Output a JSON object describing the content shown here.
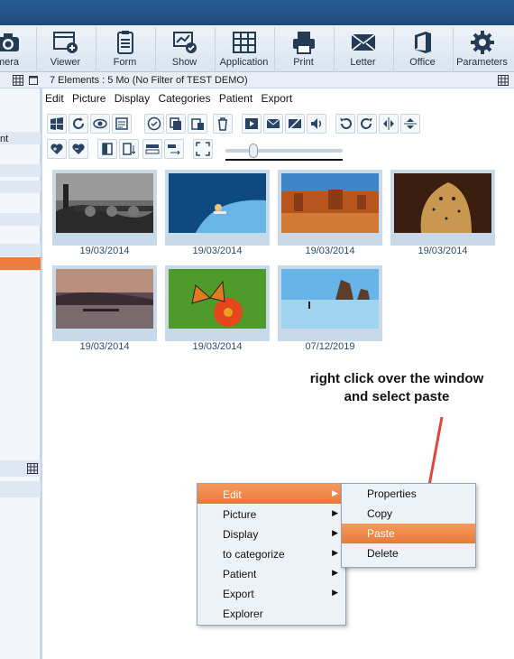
{
  "ribbon": {
    "buttons": [
      {
        "label": "mera",
        "icon": "camera-icon"
      },
      {
        "label": "Viewer",
        "icon": "viewer-icon"
      },
      {
        "label": "Form",
        "icon": "form-icon"
      },
      {
        "label": "Show",
        "icon": "show-icon"
      },
      {
        "label": "Application",
        "icon": "application-icon"
      },
      {
        "label": "Print",
        "icon": "print-icon"
      },
      {
        "label": "Letter",
        "icon": "letter-icon"
      },
      {
        "label": "Office",
        "icon": "office-icon"
      },
      {
        "label": "Parameters",
        "icon": "gear-icon"
      }
    ]
  },
  "status": {
    "text": "7 Elements : 5 Mo (No Filter of TEST DEMO)"
  },
  "sidebar": {
    "partial_label": "nt"
  },
  "menu": {
    "items": [
      "Edit",
      "Picture",
      "Display",
      "Categories",
      "Patient",
      "Export"
    ]
  },
  "gallery": {
    "items": [
      {
        "date": "19/03/2014",
        "scene": "city-bridge"
      },
      {
        "date": "19/03/2014",
        "scene": "surfer-wave"
      },
      {
        "date": "19/03/2014",
        "scene": "desert-buttes"
      },
      {
        "date": "19/03/2014",
        "scene": "cheetah"
      },
      {
        "date": "19/03/2014",
        "scene": "lake-sunset"
      },
      {
        "date": "19/03/2014",
        "scene": "butterfly-flower"
      },
      {
        "date": "07/12/2019",
        "scene": "beach-rocks"
      }
    ]
  },
  "context_menu": {
    "items": [
      "Edit",
      "Picture",
      "Display",
      "to categorize",
      "Patient",
      "Export",
      "Explorer"
    ],
    "highlighted": "Edit"
  },
  "submenu": {
    "items": [
      "Properties",
      "Copy",
      "Paste",
      "Delete"
    ],
    "highlighted": "Paste"
  },
  "annotation": {
    "line1": "right click over the window",
    "line2": "and select paste"
  },
  "colors": {
    "accent": "#e8793a",
    "titlebar": "#1d4a7c",
    "panel": "#c8d9ea"
  }
}
